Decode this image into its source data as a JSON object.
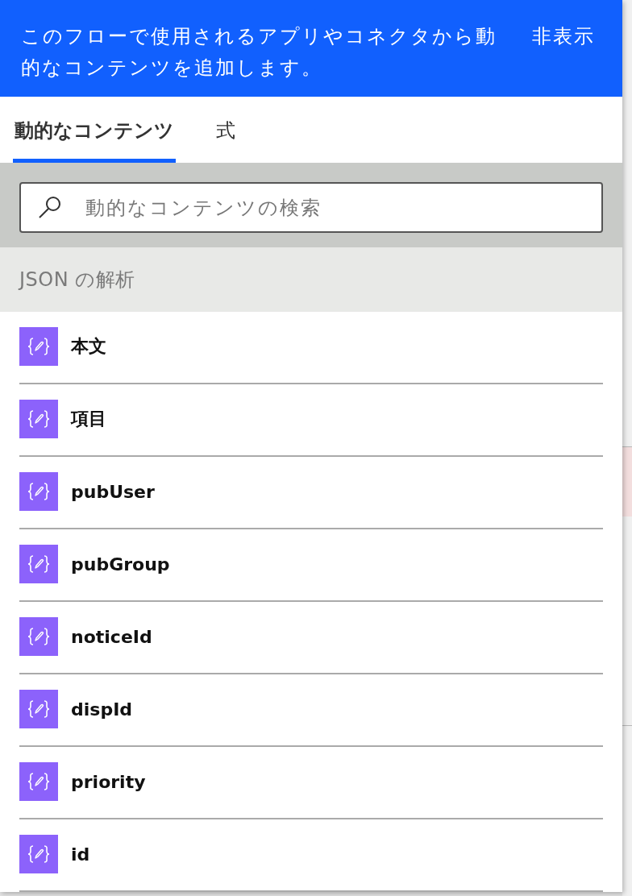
{
  "banner": {
    "message": "このフローで使用されるアプリやコネクタから動的なコンテンツを追加します。",
    "hide_button": "非表示"
  },
  "tabs": [
    {
      "label": "動的なコンテンツ",
      "selected": true
    },
    {
      "label": "式",
      "selected": false
    }
  ],
  "search": {
    "placeholder": "動的なコンテンツの検索"
  },
  "section": {
    "title": "JSON の解析",
    "items": [
      {
        "label": "本文"
      },
      {
        "label": "項目"
      },
      {
        "label": "pubUser"
      },
      {
        "label": "pubGroup"
      },
      {
        "label": "noticeId"
      },
      {
        "label": "dispId"
      },
      {
        "label": "priority"
      },
      {
        "label": "id"
      }
    ]
  }
}
